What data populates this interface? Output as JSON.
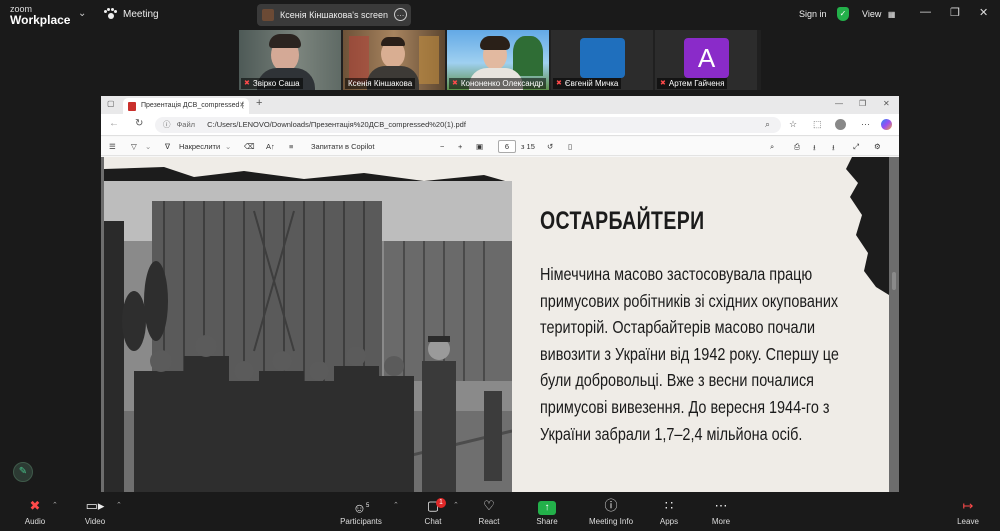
{
  "zoom": {
    "brand_line1": "zoom",
    "brand_line2": "Workplace",
    "meeting_label": "Meeting",
    "share_label": "Ксенія Кіншакова's screen",
    "sign_in": "Sign in",
    "view_label": "View",
    "accent_green": "#23b04a"
  },
  "participants": [
    {
      "name": "Звірко Саша",
      "muted": true,
      "video": true
    },
    {
      "name": "Ксенія Кіншакова",
      "muted": false,
      "video": true,
      "active": true
    },
    {
      "name": "Кононенко Олександр",
      "muted": true,
      "video": true
    },
    {
      "name": "Євгеній Мичка",
      "muted": true,
      "video": false,
      "avatar_color": "#1f6fbd"
    },
    {
      "name": "Артем Гайченя",
      "muted": true,
      "video": false,
      "avatar_letter": "A",
      "avatar_color": "#8a2bc9"
    }
  ],
  "browser": {
    "tab_title": "Презентація ДСВ_compressed (",
    "url_prefix": "Файл",
    "url": "C:/Users/LENOVO/Downloads/Презентація%20ДСВ_compressed%20(1).pdf",
    "draw_label": "Накреслити",
    "ask_copilot": "Запитати в Copilot",
    "page_current": "6",
    "page_total": "з 15"
  },
  "slide": {
    "title": "ОСТАРБАЙТЕРИ",
    "body": "Німеччина масово застосовувала працю примусових робітників зі східних окупованих територій. Остарбайтерів масово почали вивозити з України від 1942 року. Спершу це були добровольці. Вже з весни почалися примусові вивезення. До вересня 1944-го з України забрали 1,7–2,4 мільйона осіб."
  },
  "toolbar": {
    "audio": "Audio",
    "video": "Video",
    "participants": "Participants",
    "participants_count": "5",
    "chat": "Chat",
    "chat_badge": "1",
    "react": "React",
    "share": "Share",
    "meeting_info": "Meeting Info",
    "apps": "Apps",
    "more": "More",
    "leave": "Leave"
  }
}
